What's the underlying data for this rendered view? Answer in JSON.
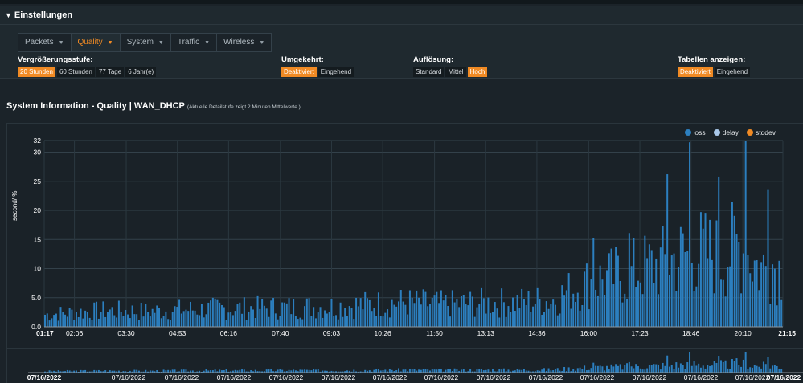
{
  "settings": {
    "title": "Einstellungen",
    "tabs": [
      {
        "label": "Packets",
        "active": false
      },
      {
        "label": "Quality",
        "active": true
      },
      {
        "label": "System",
        "active": false
      },
      {
        "label": "Traffic",
        "active": false
      },
      {
        "label": "Wireless",
        "active": false
      }
    ],
    "groups": [
      {
        "label": "Vergrößerungsstufe:",
        "options": [
          "20 Stunden",
          "60 Stunden",
          "77 Tage",
          "6 Jahr(e)"
        ],
        "selected": "20 Stunden"
      },
      {
        "label": "Umgekehrt:",
        "options": [
          "Deaktiviert",
          "Eingehend"
        ],
        "selected": "Deaktiviert"
      },
      {
        "label": "Auflösung:",
        "options": [
          "Standard",
          "Mittel",
          "Hoch"
        ],
        "selected": "Hoch"
      },
      {
        "label": "Tabellen anzeigen:",
        "options": [
          "Deaktiviert",
          "Eingehend"
        ],
        "selected": "Deaktiviert"
      }
    ]
  },
  "info": {
    "title": "System Information - Quality | WAN_DHCP",
    "note": "(Aktuelle Detailstufe zeigt 2 Minuten Mittelwerte.)"
  },
  "colors": {
    "accent": "#f08a24",
    "loss": "#2c7fbf",
    "delay": "#a9c8ea",
    "stddev": "#f08a24"
  },
  "chart_data": [
    {
      "type": "bar",
      "title": "",
      "xlabel": "",
      "ylabel": "second/ %",
      "ylim": [
        0,
        32
      ],
      "yticks": [
        0,
        5,
        10,
        15,
        20,
        25,
        30,
        32
      ],
      "ytick_labels": [
        "0.0",
        "5.0",
        "10",
        "15",
        "20",
        "25",
        "30",
        "32"
      ],
      "x_range": [
        "01:17",
        "21:15"
      ],
      "xticks": [
        "01:17",
        "02:06",
        "03:30",
        "04:53",
        "06:16",
        "07:40",
        "09:03",
        "10:26",
        "11:50",
        "13:13",
        "14:36",
        "16:00",
        "17:23",
        "18:46",
        "20:10",
        "21:15"
      ],
      "xtick_hours": [
        1.2833,
        2.1,
        3.5,
        4.8833,
        6.2667,
        7.6667,
        9.05,
        10.4333,
        11.8333,
        13.2167,
        14.6,
        16.0,
        17.3833,
        18.7667,
        20.1667,
        21.25
      ],
      "grid": true,
      "legend_position": "top-right",
      "series": [
        {
          "name": "loss",
          "color": "#2c7fbf",
          "x_hours": [
            1.2833,
            2.0,
            3.0,
            4.0,
            5.0,
            6.0,
            7.0,
            8.0,
            9.0,
            10.0,
            11.0,
            12.0,
            13.0,
            14.0,
            15.0,
            15.5,
            16.0,
            16.5,
            17.0,
            17.5,
            18.0,
            18.4,
            18.8,
            19.2,
            19.6,
            20.0,
            20.3,
            20.6,
            20.9,
            21.25
          ],
          "values": [
            3.0,
            3.5,
            4.0,
            3.8,
            4.2,
            4.5,
            4.6,
            4.8,
            5.0,
            5.5,
            6.0,
            5.5,
            5.8,
            6.0,
            6.5,
            9.0,
            11.0,
            12.0,
            13.0,
            14.5,
            15.5,
            17.0,
            18.5,
            18.0,
            17.0,
            20.0,
            18.0,
            14.0,
            16.0,
            13.0
          ]
        },
        {
          "name": "delay",
          "color": "#a9c8ea",
          "x_hours": [],
          "values": []
        },
        {
          "name": "stddev",
          "color": "#f08a24",
          "x_hours": [],
          "values": []
        }
      ],
      "peaks": [
        {
          "time_hours": 16.1,
          "value": 15.2
        },
        {
          "time_hours": 17.05,
          "value": 16.1
        },
        {
          "time_hours": 18.1,
          "value": 26.2
        },
        {
          "time_hours": 18.72,
          "value": 31.7
        },
        {
          "time_hours": 19.5,
          "value": 25.8
        },
        {
          "time_hours": 20.22,
          "value": 32.0
        },
        {
          "time_hours": 20.82,
          "value": 23.5
        }
      ]
    },
    {
      "type": "bar",
      "title": "",
      "xlabel": "",
      "ylabel": "",
      "x_range": [
        "07/16/2022",
        "07/16/2022"
      ],
      "xticks": [
        "07/16/2022",
        "07/16/2022",
        "07/16/2022",
        "07/16/2022",
        "07/16/2022",
        "07/16/2022",
        "07/16/2022",
        "07/16/2022",
        "07/16/2022",
        "07/16/2022",
        "07/16/2022",
        "07/16/2022",
        "07/16/2022",
        "07/16/2022",
        "07/16/2022",
        "07/16/2022"
      ],
      "series": [
        {
          "name": "loss",
          "color": "#2c7fbf"
        }
      ]
    }
  ]
}
